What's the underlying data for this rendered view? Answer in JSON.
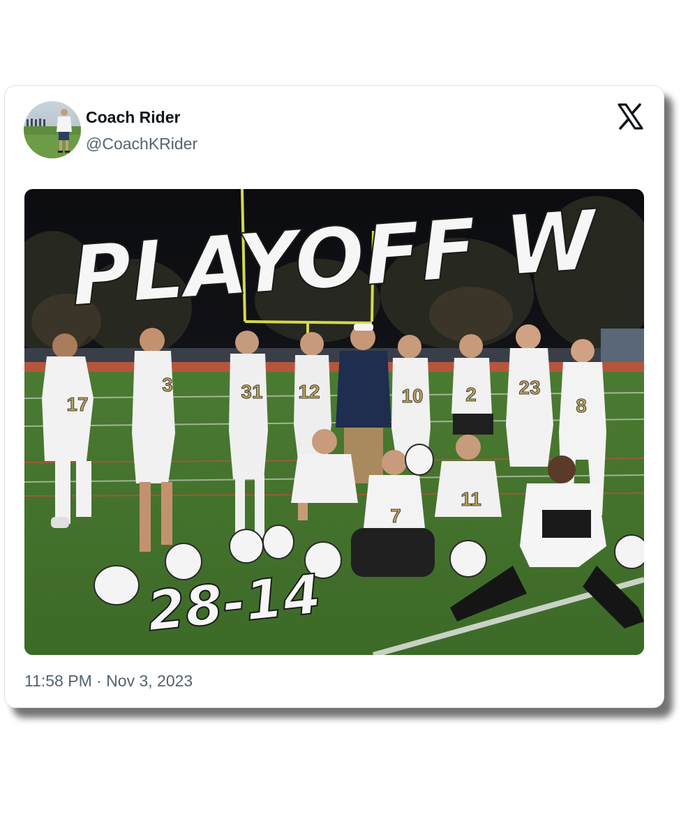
{
  "tweet": {
    "display_name": "Coach Rider",
    "handle": "@CoachKRider",
    "timestamp": "11:58 PM · Nov 3, 2023"
  },
  "media": {
    "headline": "PLAYOFF W",
    "score": "28-14",
    "jersey_numbers": [
      "17",
      "3",
      "31",
      "12",
      "10",
      "2",
      "23",
      "8",
      "11",
      "7",
      "11"
    ]
  },
  "icons": {
    "brand": "x-logo-icon"
  },
  "colors": {
    "text_primary": "#0f1419",
    "text_secondary": "#536471",
    "card_border": "#dfe3e8",
    "uniform_gold": "#b9a25c"
  }
}
